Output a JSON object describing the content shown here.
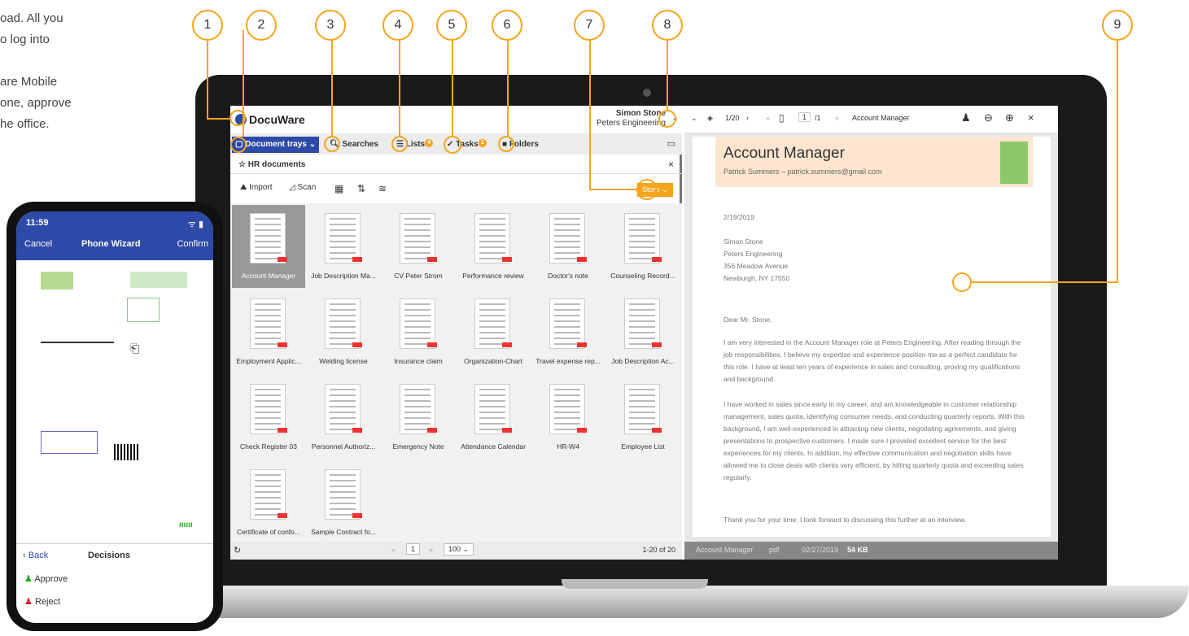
{
  "intro": {
    "line1": "oad. All you",
    "line2": "o log into",
    "line3": "are Mobile",
    "line4": "one, approve",
    "line5": "he office."
  },
  "callouts": [
    "1",
    "2",
    "3",
    "4",
    "5",
    "6",
    "7",
    "8",
    "9"
  ],
  "app": {
    "logo": "DocuWare",
    "user_name": "Simon Stone",
    "user_company": "Peters Engineering",
    "nav": {
      "trays": "Document trays",
      "searches": "Searches",
      "lists": "Lists",
      "lists_badge": "4",
      "tasks": "Tasks",
      "tasks_badge": "1",
      "folders": "Folders"
    },
    "crumb": "HR documents",
    "close": "×",
    "toolbar": {
      "import": "Import",
      "scan": "Scan",
      "store": "Store"
    },
    "docs": [
      "Account Manager",
      "Job Description Ma...",
      "CV Peter Strom",
      "Performance review",
      "Doctor's note",
      "Counseling Record...",
      "Employment Applic...",
      "Welding license",
      "Insurance claim",
      "Organization-Chart",
      "Travel expense rep...",
      "Job Description Ac...",
      "Check Register 03",
      "Personnel Authoriz...",
      "Emergency Note",
      "Attendance Calendar",
      "HR-W4",
      "Employee List",
      "Certificate of confo...",
      "Sample Contract fo..."
    ],
    "footer": {
      "page": "1",
      "per_page": "100",
      "range": "1-20 of 20"
    }
  },
  "viewer": {
    "pages": "1/20",
    "page_no": "1",
    "page_total": "/1",
    "doc_title": "Account Manager",
    "letter": {
      "title": "Account Manager",
      "subtitle": "Patrick Summers – patrick.summers@gmail.com",
      "date": "2/19/2019",
      "addr1": "Simon Stone",
      "addr2": "Peters Engineering",
      "addr3": "356 Meadow Avenue",
      "addr4": "Newburgh, NY 17550",
      "greeting": "Dear Mr. Stone,",
      "p1": "I am very interested in the Account Manager role at Peters Engineering. After reading through the job responsibilities, I believe my expertise and experience position me as a perfect candidate for this role. I have at least ten years of experience in sales and consulting, proving my qualifications and background.",
      "p2": "I have worked in sales since early in my career, and am knowledgeable in customer relationship management, sales quota, identifying consumer needs, and conducting quarterly reports. With this background, I am well-experienced in attracting new clients, negotiating agreements, and giving presentations to prospective customers. I made sure I provided excellent service for the best experiences for my clients. In addition, my effective communication and negotiation skills have allowed me to close deals with clients very efficient, by hitting quarterly quota and exceeding sales regularly.",
      "p3": "Thank you for your time. I look forward to discussing this further at an interview."
    },
    "footer": {
      "name": "Account Manager",
      "type": "pdf",
      "date": "02/27/2019",
      "size": "54 KB"
    }
  },
  "phone": {
    "time": "11:59",
    "cancel": "Cancel",
    "title": "Phone Wizard",
    "confirm": "Confirm",
    "back": "Back",
    "decisions": "Decisions",
    "approve": "Approve",
    "reject": "Reject"
  }
}
